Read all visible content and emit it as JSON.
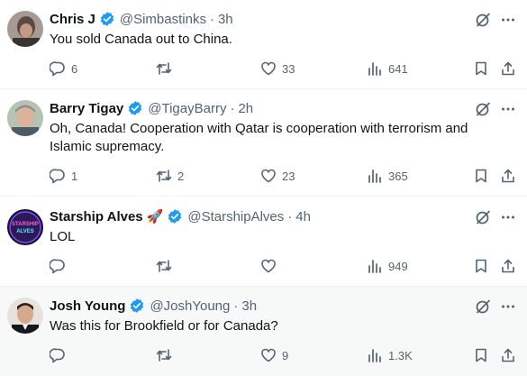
{
  "colors": {
    "text": "#0f1419",
    "secondary": "#536471",
    "verified": "#1d9bf0",
    "divider": "#eff3f4",
    "highlight_bg": "#f7f9f9"
  },
  "icons": {
    "verified": "verified-badge-icon",
    "grok": "grok-icon",
    "more": "more-options-icon",
    "reply": "reply-icon",
    "retweet": "retweet-icon",
    "like": "like-icon",
    "views": "views-icon",
    "bookmark": "bookmark-icon",
    "share": "share-icon"
  },
  "tweets": [
    {
      "name": "Chris J",
      "handle": "@Simbastinks",
      "separator": "·",
      "time": "3h",
      "text": "You sold Canada out to China.",
      "replies": "6",
      "retweets": "",
      "likes": "33",
      "views": "641"
    },
    {
      "name": "Barry Tigay",
      "handle": "@TigayBarry",
      "separator": "·",
      "time": "2h",
      "text": "Oh, Canada! Cooperation with Qatar is cooperation with terrorism and Islamic supremacy.",
      "replies": "1",
      "retweets": "2",
      "likes": "23",
      "views": "365"
    },
    {
      "name": "Starship Alves",
      "emoji": "🚀",
      "handle": "@StarshipAlves",
      "separator": "·",
      "time": "4h",
      "avatar_text": [
        "STARSHIP",
        "ALVES"
      ],
      "text": "LOL",
      "replies": "",
      "retweets": "",
      "likes": "",
      "views": "949"
    },
    {
      "name": "Josh Young",
      "handle": "@JoshYoung",
      "separator": "·",
      "time": "3h",
      "text": "Was this for Brookfield or for Canada?",
      "replies": "",
      "retweets": "",
      "likes": "9",
      "views": "1.3K"
    }
  ]
}
